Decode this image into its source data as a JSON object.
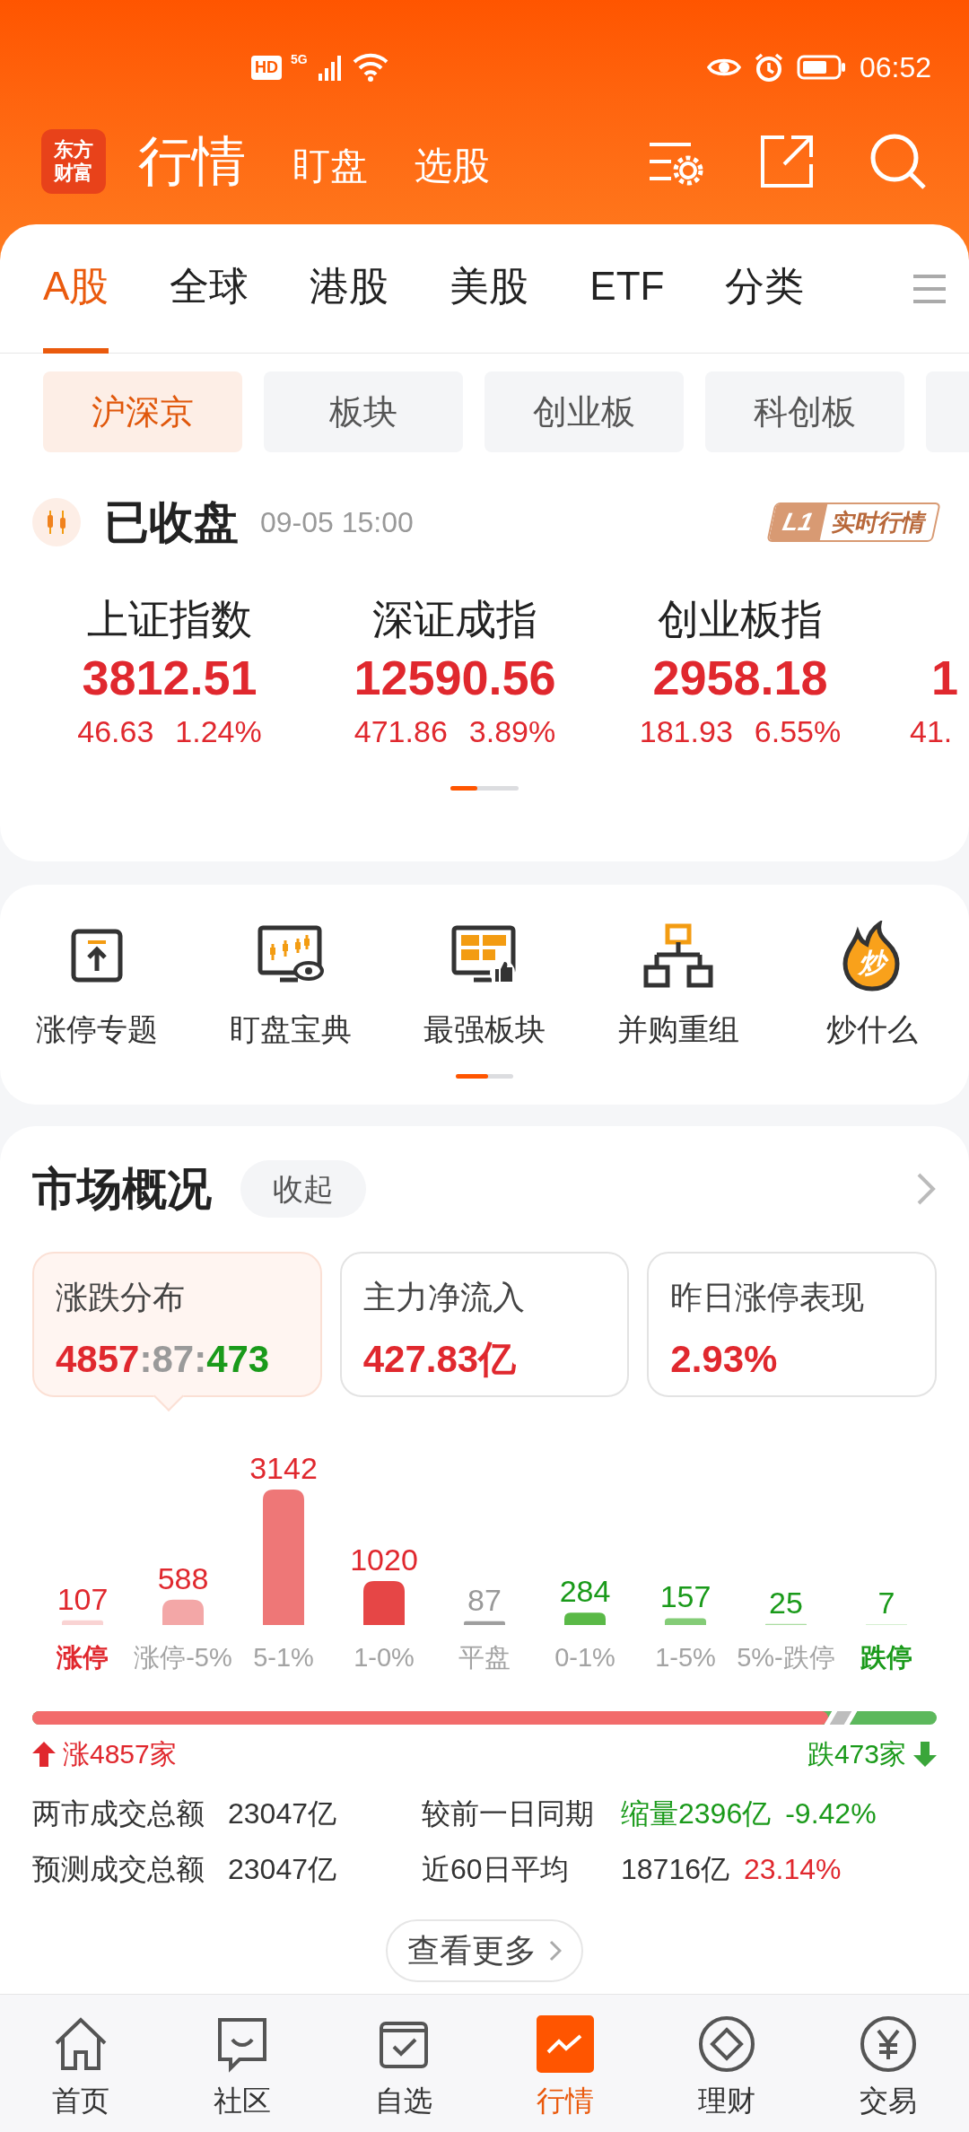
{
  "status_bar": {
    "hd": "HD",
    "network": "5G",
    "time": "06:52"
  },
  "header": {
    "logo_lines": [
      "东方",
      "财富"
    ],
    "title": "行情",
    "links": [
      "盯盘",
      "选股"
    ]
  },
  "tabs": [
    {
      "label": "A股",
      "selected": true
    },
    {
      "label": "全球",
      "selected": false
    },
    {
      "label": "港股",
      "selected": false
    },
    {
      "label": "美股",
      "selected": false
    },
    {
      "label": "ETF",
      "selected": false
    },
    {
      "label": "分类",
      "selected": false
    }
  ],
  "filters": [
    {
      "label": "沪深京",
      "selected": true
    },
    {
      "label": "板块",
      "selected": false
    },
    {
      "label": "创业板",
      "selected": false
    },
    {
      "label": "科创板",
      "selected": false
    }
  ],
  "session": {
    "status": "已收盘",
    "time": "09-05 15:00",
    "badge_level": "L1",
    "badge_text": "实时行情"
  },
  "indices": [
    {
      "name": "上证指数",
      "value": "3812.51",
      "change": "46.63",
      "percent": "1.24%"
    },
    {
      "name": "深证成指",
      "value": "12590.56",
      "change": "471.86",
      "percent": "3.89%"
    },
    {
      "name": "创业板指",
      "value": "2958.18",
      "change": "181.93",
      "percent": "6.55%"
    },
    {
      "value": "1",
      "change": "41."
    }
  ],
  "shortcuts": [
    {
      "label": "涨停专题",
      "kind": "upload"
    },
    {
      "label": "盯盘宝典",
      "kind": "monitor"
    },
    {
      "label": "最强板块",
      "kind": "board"
    },
    {
      "label": "并购重组",
      "kind": "tree"
    },
    {
      "label": "炒什么",
      "kind": "flame",
      "glyph": "炒"
    }
  ],
  "market": {
    "title": "市场概况",
    "collapse": "收起",
    "cards": [
      {
        "label": "涨跌分布",
        "selected": true,
        "parts": [
          {
            "text": "4857",
            "kind": "up"
          },
          {
            "text": ":",
            "kind": "flat"
          },
          {
            "text": "87",
            "kind": "flat"
          },
          {
            "text": ":",
            "kind": "flat"
          },
          {
            "text": "473",
            "kind": "down"
          }
        ]
      },
      {
        "label": "主力净流入",
        "selected": false,
        "parts": [
          {
            "text": "427.83亿",
            "kind": "up"
          }
        ]
      },
      {
        "label": "昨日涨停表现",
        "selected": false,
        "parts": [
          {
            "text": "2.93%",
            "kind": "up"
          }
        ]
      }
    ],
    "distribution": {
      "chart_data": {
        "type": "bar",
        "categories": [
          "涨停",
          "涨停-5%",
          "5-1%",
          "1-0%",
          "平盘",
          "0-1%",
          "1-5%",
          "5%-跌停",
          "跌停"
        ],
        "values": [
          107,
          588,
          3142,
          1020,
          87,
          284,
          157,
          25,
          7
        ],
        "data_labels": true
      },
      "bars": [
        {
          "color": "#f9d3d3",
          "kind": "up",
          "emphasis": true
        },
        {
          "color": "#f3a7a7",
          "kind": "up",
          "emphasis": false
        },
        {
          "color": "#ee7777",
          "kind": "up",
          "emphasis": false
        },
        {
          "color": "#e64646",
          "kind": "up",
          "emphasis": false
        },
        {
          "color": "#9e9e9e",
          "kind": "flat",
          "emphasis": false
        },
        {
          "color": "#5ab947",
          "kind": "down",
          "emphasis": false
        },
        {
          "color": "#84cc77",
          "kind": "down",
          "emphasis": false
        },
        {
          "color": "#aadca0",
          "kind": "down",
          "emphasis": false
        },
        {
          "color": "#d5efd0",
          "kind": "down",
          "emphasis": true
        }
      ]
    },
    "breadth": {
      "level": 0.88,
      "up_label": "涨4857家",
      "down_label": "跌473家"
    },
    "stats": [
      {
        "label": "两市成交总额",
        "value": "23047亿",
        "compare_label": "较前一日同期",
        "compare_value": {
          "text": "缩量2396亿",
          "kind": "down"
        },
        "percent": {
          "text": "-9.42%",
          "kind": "down"
        }
      },
      {
        "label": "预测成交总额",
        "value": "23047亿",
        "compare_label": "近60日平均",
        "compare_value": {
          "text": "18716亿",
          "kind": "neutral"
        },
        "percent": {
          "text": "23.14%",
          "kind": "up"
        }
      }
    ],
    "more_button": "查看更多"
  },
  "nav": [
    {
      "label": "首页",
      "kind": "home",
      "selected": false
    },
    {
      "label": "社区",
      "kind": "chat",
      "selected": false
    },
    {
      "label": "自选",
      "kind": "check",
      "selected": false
    },
    {
      "label": "行情",
      "kind": "chart",
      "selected": true
    },
    {
      "label": "理财",
      "kind": "diamond",
      "selected": false
    },
    {
      "label": "交易",
      "kind": "yen",
      "selected": false
    }
  ]
}
